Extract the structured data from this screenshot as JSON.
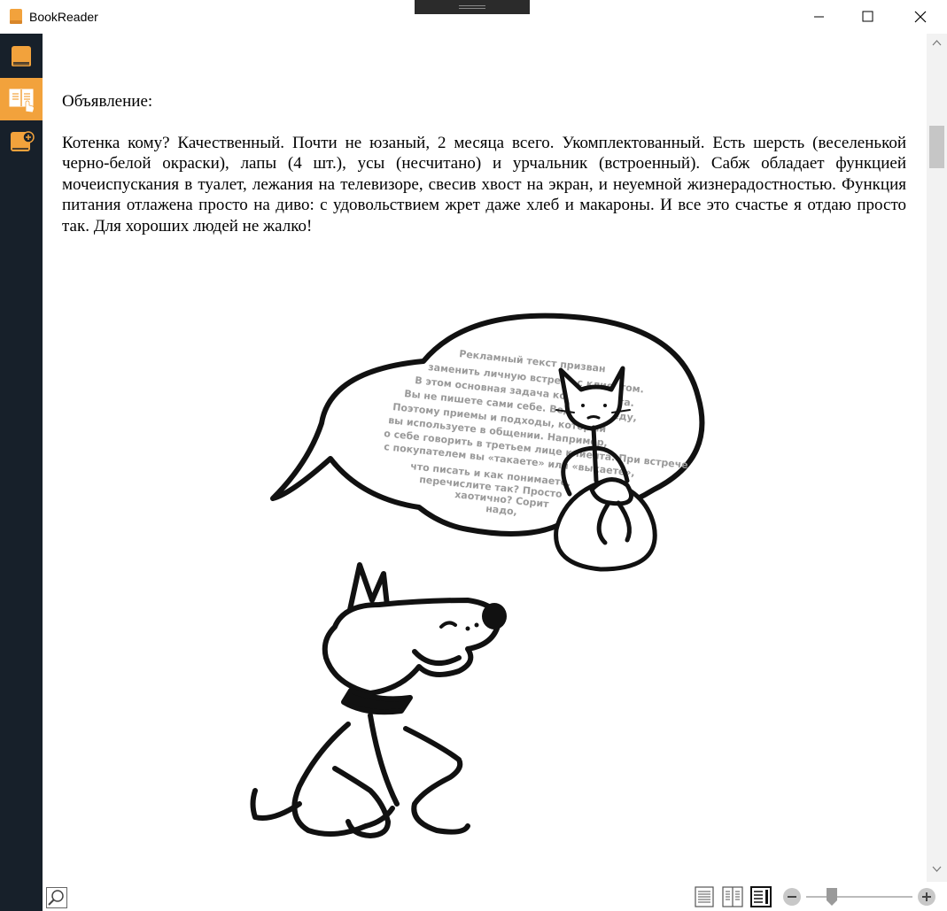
{
  "window": {
    "title": "BookReader",
    "accent": "#f2a23c",
    "rail_color": "#17202a"
  },
  "sidebar": {
    "items": [
      {
        "icon": "book-icon",
        "active": false
      },
      {
        "icon": "reader-icon",
        "active": true
      },
      {
        "icon": "add-book-icon",
        "active": false
      }
    ]
  },
  "content": {
    "heading": "Объявление:",
    "body": "Котенка кому? Качественный. Почти не юзаный, 2 месяца всего. Укомплектованный. Есть шерсть (веселенькой черно-белой окраски), лапы (4 шт.), усы (несчитано) и урчальник (встроенный). Сабж обладает функцией мочеиспускания в туалет, лежания на телевизоре, свесив хвост на экран, и неуемной жизнерадостностью. Функция питания отлажена просто на диво: с удовольствием жрет даже хлеб и макароны. И все это счастье я отдаю просто так. Для хороших людей не жалко!",
    "illustration_text": [
      "Рекламный текст призван",
      "заменить личную встречу с клиентом.",
      "В этом основная задача копирайтинга.",
      "Вы не пишете сами себе. Ведете беседу,",
      "Поэтому приемы и подходы, который",
      "вы используете в общении. Например,",
      "о себе говорить в третьем лице клиента. При встрече",
      "с покупателем вы «такаете» или «выкаете»,",
      "что писать и как понимаете,",
      "перечислите так? Просто",
      "хаотично? Сорит",
      "надо,"
    ]
  },
  "viewer": {
    "zoom_level": 0.2,
    "scroll_position": 0.07,
    "view_modes": [
      "single-page",
      "two-page",
      "scroll"
    ],
    "active_view_mode": "scroll"
  }
}
